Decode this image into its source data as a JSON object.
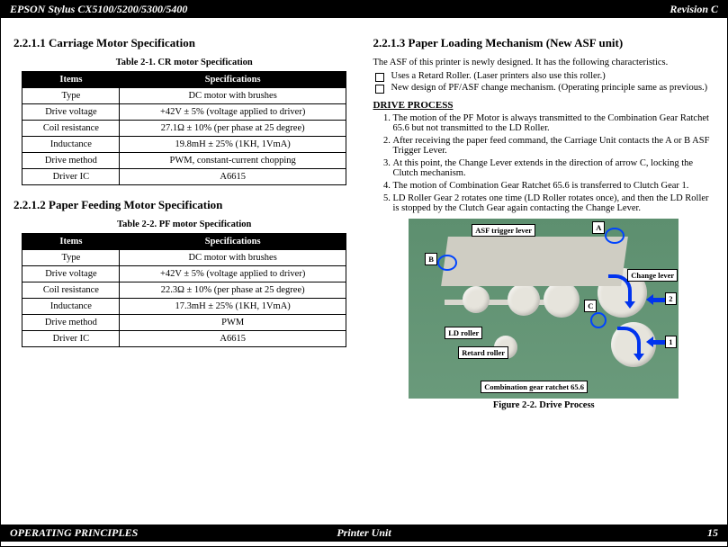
{
  "header": {
    "left": "EPSON Stylus CX5100/5200/5300/5400",
    "right": "Revision C"
  },
  "footer": {
    "left": "OPERATING PRINCIPLES",
    "center": "Printer Unit",
    "right": "15"
  },
  "left": {
    "s1": {
      "title": "2.2.1.1  Carriage Motor Specification",
      "tableTitle": "Table 2-1. CR motor Specification",
      "headers": [
        "Items",
        "Specifications"
      ],
      "rows": [
        [
          "Type",
          "DC motor with brushes"
        ],
        [
          "Drive voltage",
          "+42V ± 5% (voltage applied to driver)"
        ],
        [
          "Coil resistance",
          "27.1Ω ± 10% (per phase at 25 degree)"
        ],
        [
          "Inductance",
          "19.8mH ± 25% (1KH, 1VmA)"
        ],
        [
          "Drive method",
          "PWM, constant-current chopping"
        ],
        [
          "Driver IC",
          "A6615"
        ]
      ]
    },
    "s2": {
      "title": "2.2.1.2  Paper Feeding Motor Specification",
      "tableTitle": "Table 2-2. PF motor Specification",
      "headers": [
        "Items",
        "Specifications"
      ],
      "rows": [
        [
          "Type",
          "DC motor with brushes"
        ],
        [
          "Drive voltage",
          "+42V ± 5% (voltage applied to driver)"
        ],
        [
          "Coil resistance",
          "22.3Ω ± 10% (per phase at 25 degree)"
        ],
        [
          "Inductance",
          "17.3mH ± 25% (1KH, 1VmA)"
        ],
        [
          "Drive method",
          "PWM"
        ],
        [
          "Driver IC",
          "A6615"
        ]
      ]
    }
  },
  "right": {
    "title": "2.2.1.3  Paper Loading Mechanism (New ASF unit)",
    "intro": "The ASF of this printer is newly designed. It has the following characteristics.",
    "bullets": [
      "Uses a Retard Roller. (Laser printers also use this roller.)",
      "New design of PF/ASF change mechanism. (Operating principle same as previous.)"
    ],
    "subhead": "DRIVE PROCESS",
    "steps": [
      "The motion of the PF Motor is always transmitted to the Combination Gear Ratchet 65.6 but not transmitted to the LD Roller.",
      "After receiving the paper feed command, the Carriage Unit contacts the A or B ASF Trigger Lever.",
      "At this point, the Change Lever extends in the direction of arrow C, locking the Clutch mechanism.",
      "The motion of Combination Gear Ratchet 65.6 is transferred to Clutch Gear 1.",
      "LD Roller Gear 2 rotates one time (LD Roller rotates once), and then the LD Roller is stopped by the Clutch Gear again contacting the Change Lever."
    ],
    "figure": {
      "caption": "Figure 2-2. Drive Process",
      "labels": {
        "asf": "ASF trigger lever",
        "a": "A",
        "b": "B",
        "c": "C",
        "change": "Change lever",
        "n1": "1",
        "n2": "2",
        "ld": "LD roller",
        "retard": "Retard roller",
        "combo": "Combination gear ratchet 65.6"
      }
    }
  }
}
